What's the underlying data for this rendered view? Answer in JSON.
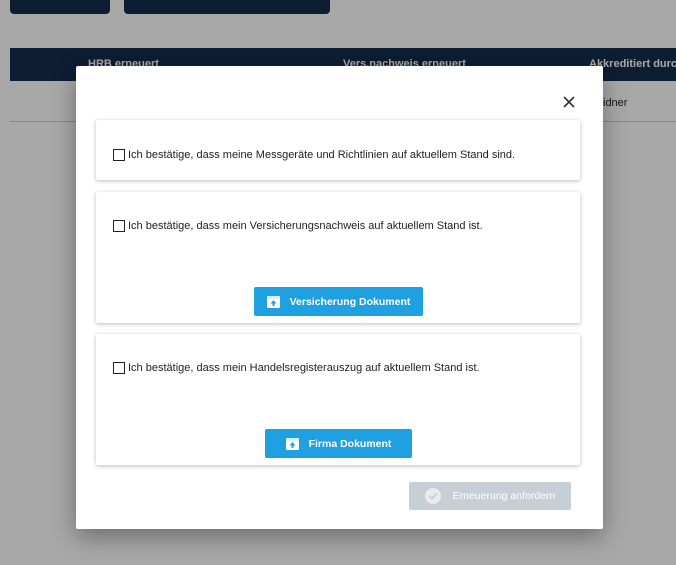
{
  "background": {
    "table_headers": [
      "HRB erneuert",
      "Vers.nachweis erneuert",
      "Akkreditiert durch"
    ],
    "row_partial_text": "idner"
  },
  "modal": {
    "close_icon": "close-icon",
    "confirmations": [
      {
        "label": "Ich bestätige, dass meine Messgeräte und Richtlinien auf aktuellem Stand sind.",
        "checked": false
      },
      {
        "label": "Ich bestätige, dass mein Versicherungsnachweis auf aktuellem Stand ist.",
        "checked": false,
        "button_label": "Versicherung Dokument",
        "button_icon": "document-upload-icon"
      },
      {
        "label": "Ich bestätige, dass mein Handelsregisterauszug auf aktuellem Stand ist.",
        "checked": false,
        "button_label": "Firma Dokument",
        "button_icon": "document-upload-icon"
      }
    ],
    "submit": {
      "label": "Erneuerung anfordern",
      "icon": "check-circle-icon",
      "disabled": true
    }
  },
  "colors": {
    "header_navy": "#152c4d",
    "accent_blue": "#1fa0e0",
    "disabled_gray": "#c7cfd6"
  }
}
